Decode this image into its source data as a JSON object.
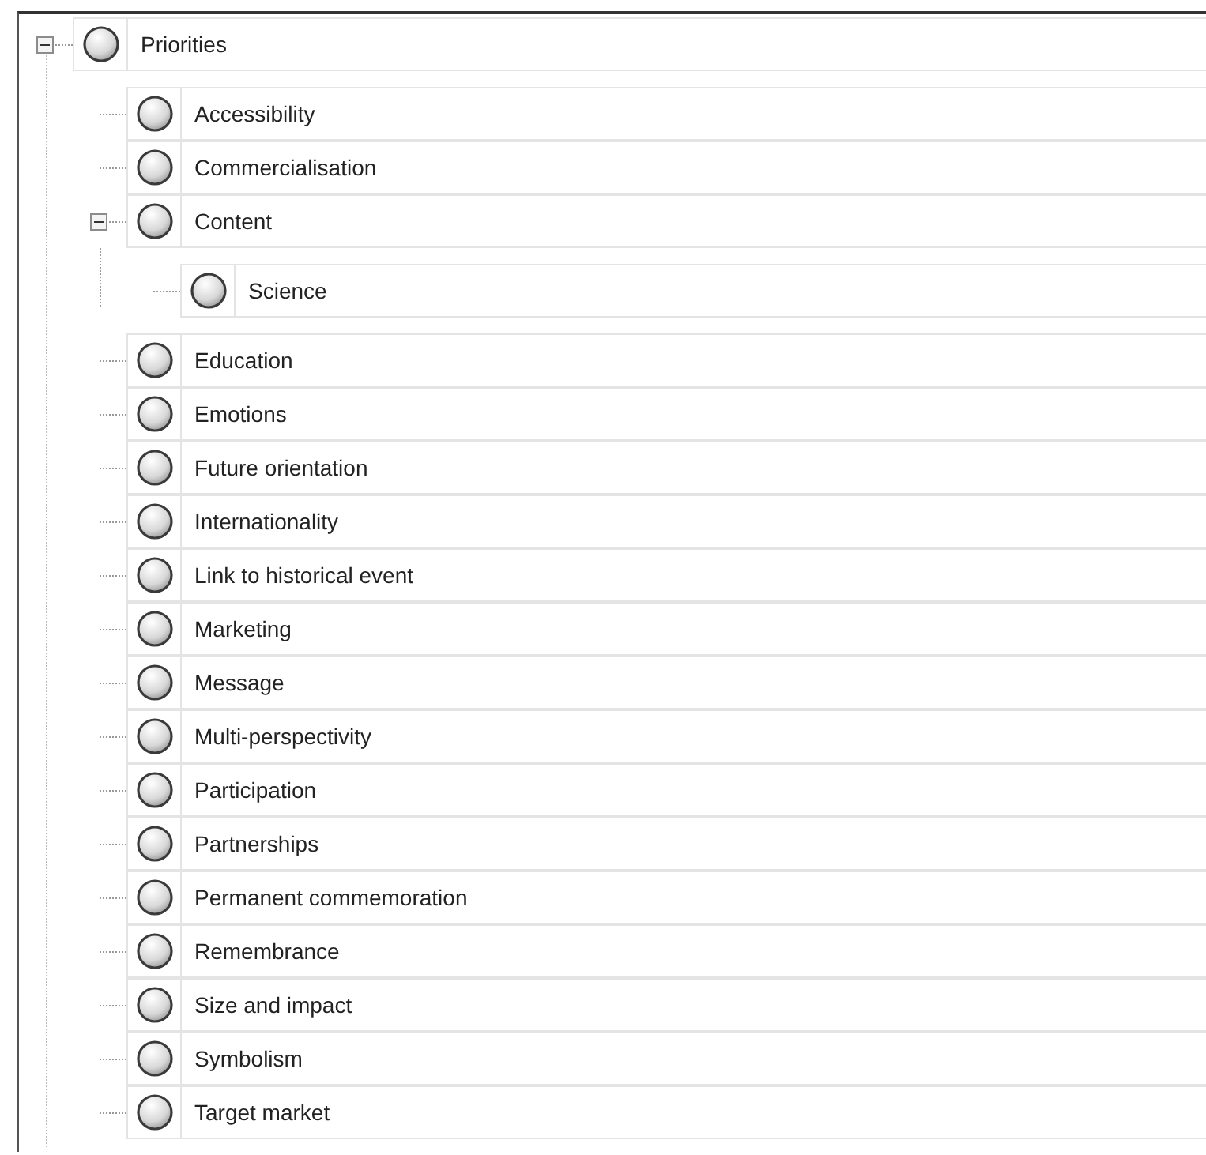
{
  "tree": [
    {
      "label": "Priorities",
      "expanded": true,
      "children": [
        {
          "label": "Accessibility"
        },
        {
          "label": "Commercialisation"
        },
        {
          "label": "Content",
          "expanded": true,
          "children": [
            {
              "label": "Science"
            }
          ]
        },
        {
          "label": "Education"
        },
        {
          "label": "Emotions"
        },
        {
          "label": "Future orientation"
        },
        {
          "label": "Internationality"
        },
        {
          "label": "Link to historical event"
        },
        {
          "label": "Marketing"
        },
        {
          "label": "Message"
        },
        {
          "label": "Multi-perspectivity"
        },
        {
          "label": "Participation"
        },
        {
          "label": "Partnerships"
        },
        {
          "label": "Permanent commemoration"
        },
        {
          "label": "Remembrance"
        },
        {
          "label": "Size and impact"
        },
        {
          "label": "Symbolism"
        },
        {
          "label": "Target market"
        }
      ]
    }
  ]
}
